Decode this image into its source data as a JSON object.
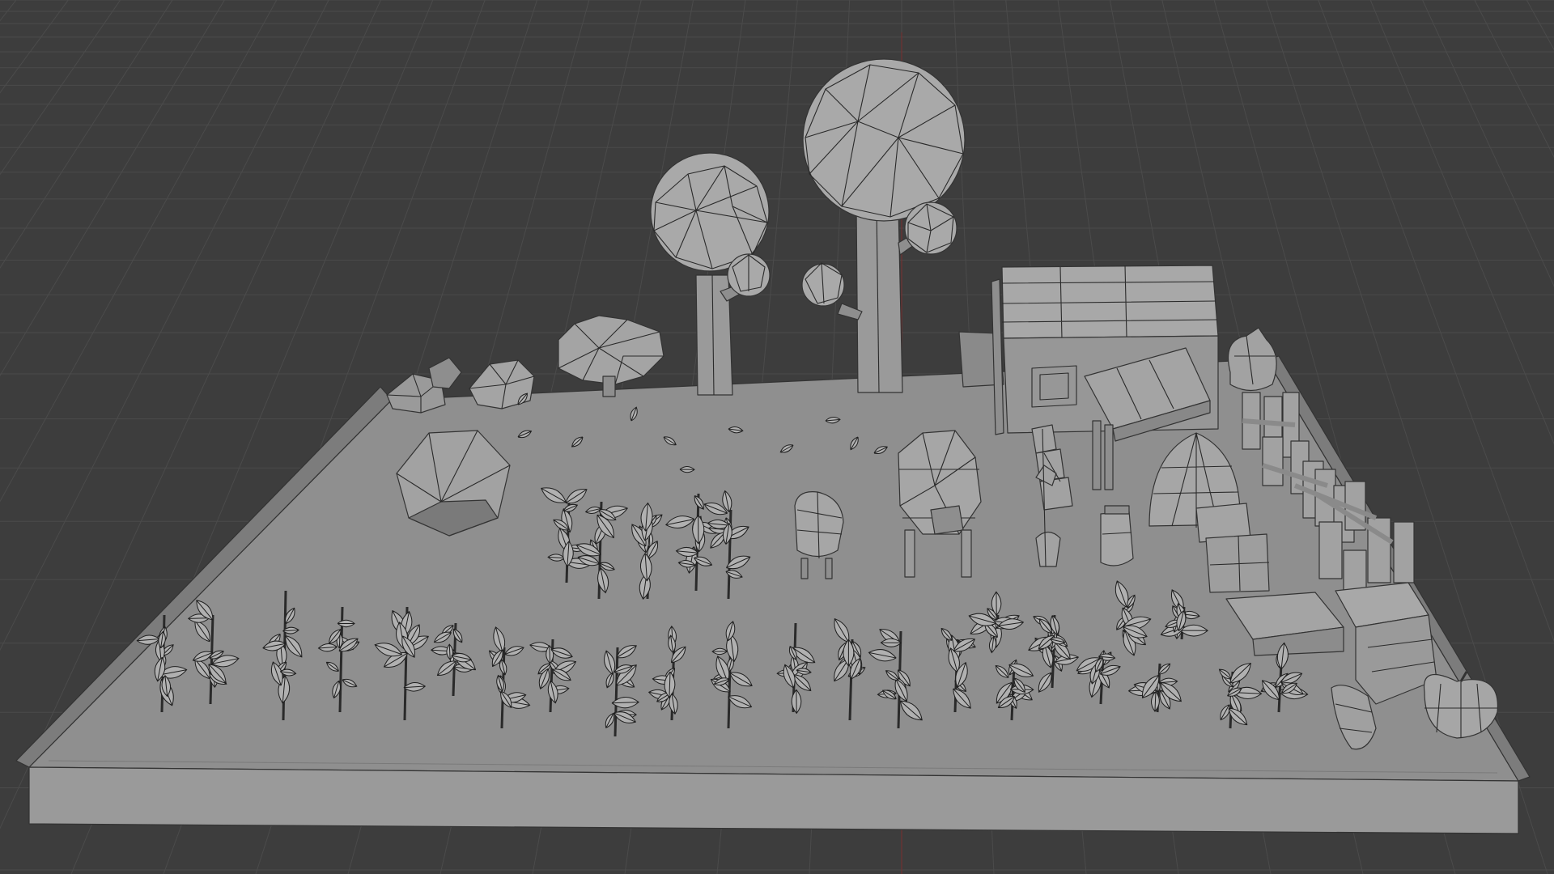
{
  "viewport": {
    "mode": "solid-wireframe-overlay",
    "colors": {
      "background": "#3d3d3d",
      "grid_line": "#4a4a4a",
      "grid_fine": "#434343",
      "axis_y": "#7a2e2e",
      "base_top": "#8f8f8f",
      "base_front": "#9a9a9a",
      "base_side": "#7c7c7c",
      "mesh_light": "#a9a9a9",
      "mesh_mid": "#8e8e8e",
      "mesh_dark": "#707070",
      "edge": "#2a2a2a"
    }
  },
  "scene": {
    "objects": [
      {
        "name": "tree-large",
        "icon": "low-poly-tree"
      },
      {
        "name": "tree-small",
        "icon": "low-poly-tree"
      },
      {
        "name": "bush",
        "icon": "bush"
      },
      {
        "name": "rocks",
        "icon": "rock"
      },
      {
        "name": "big-rock",
        "icon": "rock"
      },
      {
        "name": "barn",
        "icon": "barn"
      },
      {
        "name": "hay-tent",
        "icon": "tent"
      },
      {
        "name": "fence",
        "icon": "fence"
      },
      {
        "name": "crates",
        "icon": "crate"
      },
      {
        "name": "pig",
        "icon": "pig"
      },
      {
        "name": "sheep",
        "icon": "sheep"
      },
      {
        "name": "chickens",
        "icon": "chicken"
      },
      {
        "name": "milk-jar",
        "icon": "jar"
      },
      {
        "name": "sack",
        "icon": "sack"
      },
      {
        "name": "pumpkin",
        "icon": "pumpkin"
      },
      {
        "name": "crop-rows",
        "icon": "plants"
      },
      {
        "name": "hay-bales",
        "icon": "hay-bale"
      }
    ]
  }
}
